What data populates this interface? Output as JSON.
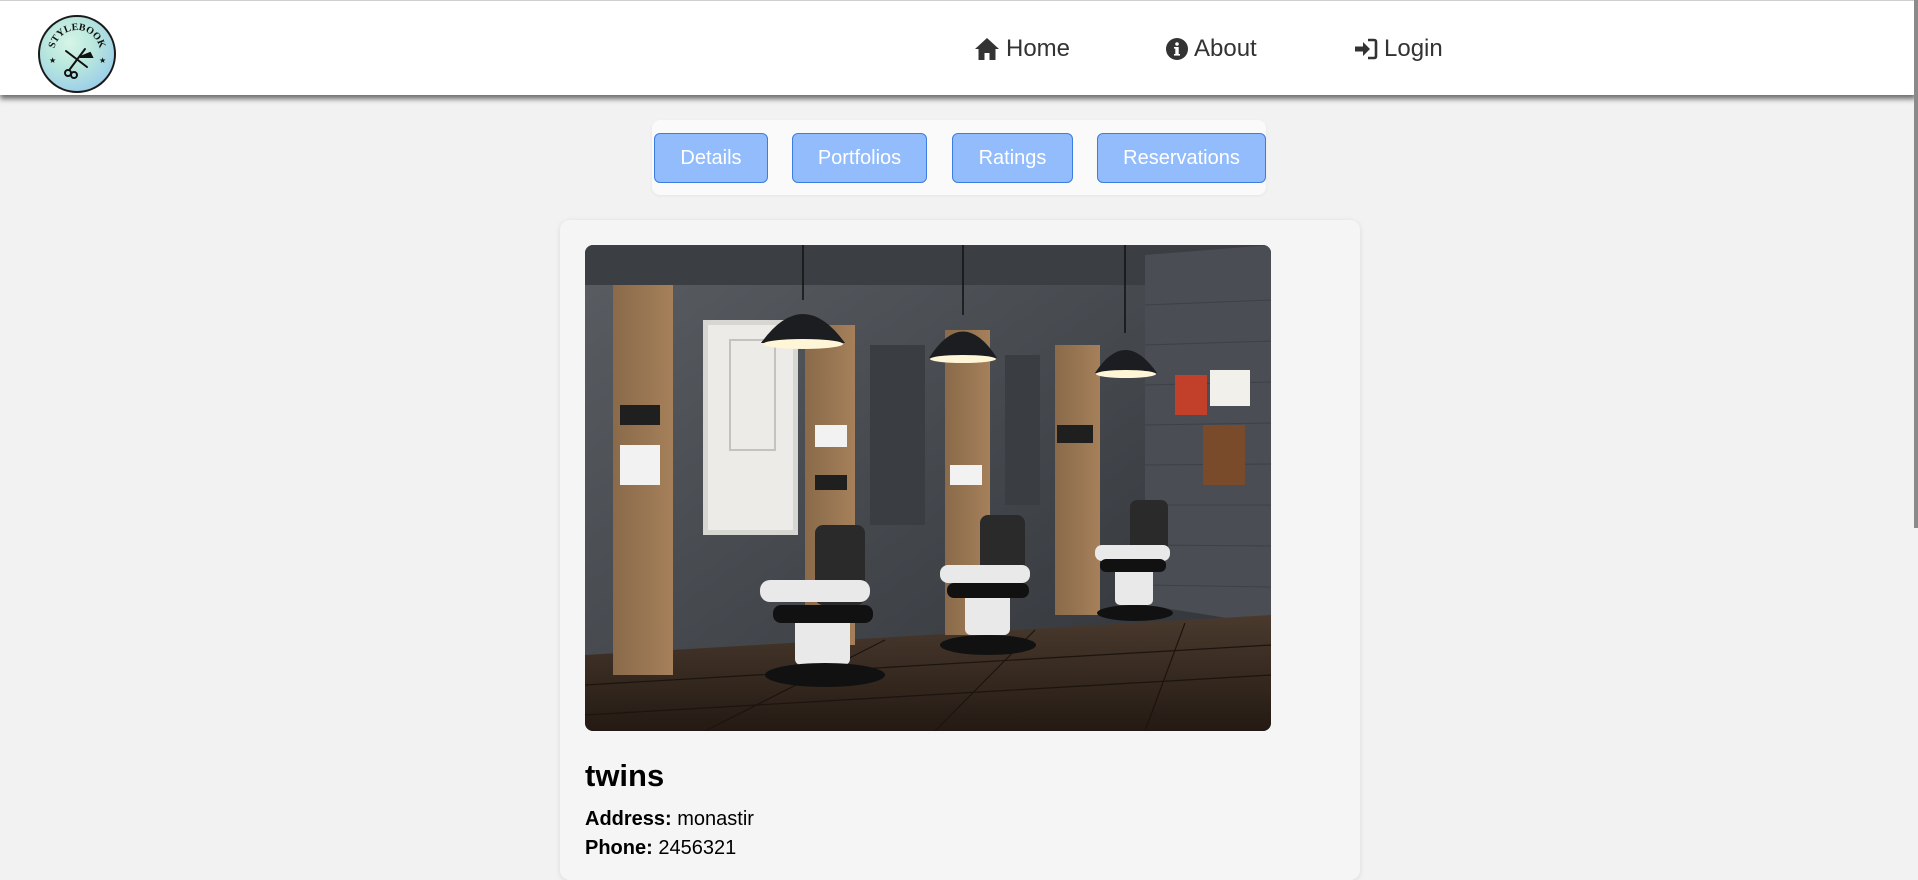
{
  "logo": {
    "text": "STYLEBOOK"
  },
  "nav": {
    "home": {
      "label": "Home",
      "icon": "home-icon"
    },
    "about": {
      "label": "About",
      "icon": "info-circle-icon"
    },
    "login": {
      "label": "Login",
      "icon": "sign-in-icon"
    }
  },
  "tabs": {
    "details": "Details",
    "portfolios": "Portfolios",
    "ratings": "Ratings",
    "reservations": "Reservations"
  },
  "salon": {
    "name": "twins",
    "address_label": "Address:",
    "address": "monastir",
    "phone_label": "Phone:",
    "phone": "2456321"
  },
  "colors": {
    "tab_bg": "#92bcfb",
    "tab_border": "#3b7de0",
    "page_bg": "#f2f2f2"
  }
}
